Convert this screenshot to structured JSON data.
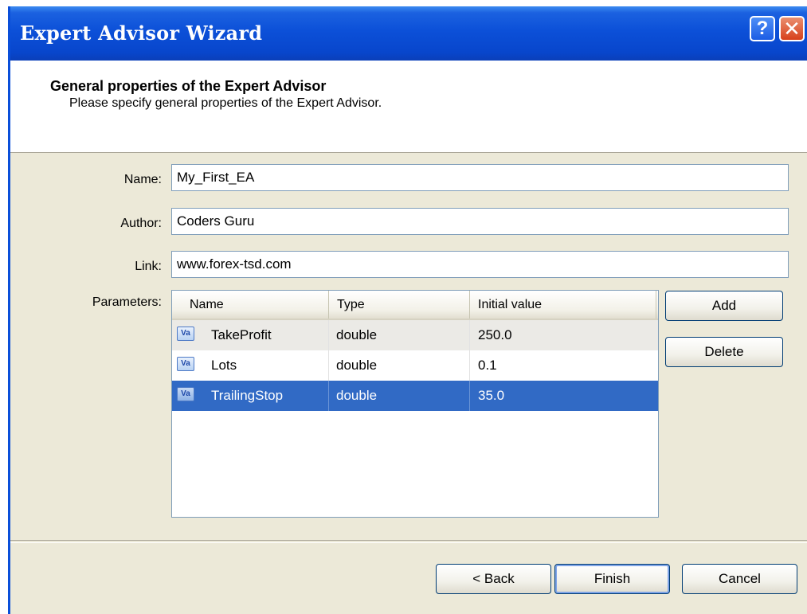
{
  "window": {
    "title": "Expert Advisor Wizard"
  },
  "header": {
    "title": "General properties of the Expert Advisor",
    "subtitle": "Please specify general properties of the Expert Advisor."
  },
  "form": {
    "name_label": "Name:",
    "name_value": "My_First_EA",
    "author_label": "Author:",
    "author_value": "Coders Guru",
    "link_label": "Link:",
    "link_value": "www.forex-tsd.com",
    "parameters_label": "Parameters:"
  },
  "parameters_table": {
    "columns": [
      "Name",
      "Type",
      "Initial value"
    ],
    "rows": [
      {
        "name": "TakeProfit",
        "type": "double",
        "value": "250.0",
        "icon": "variable-icon"
      },
      {
        "name": "Lots",
        "type": "double",
        "value": "0.1",
        "icon": "variable-icon"
      },
      {
        "name": "TrailingStop",
        "type": "double",
        "value": "35.0",
        "icon": "variable-icon",
        "selected": true
      }
    ]
  },
  "side_buttons": {
    "add": "Add",
    "delete": "Delete"
  },
  "footer_buttons": {
    "back": "< Back",
    "finish": "Finish",
    "cancel": "Cancel"
  },
  "colors": {
    "titlebar": "#0846cc",
    "selection": "#316ac5",
    "dialog_bg": "#ece9d8"
  }
}
